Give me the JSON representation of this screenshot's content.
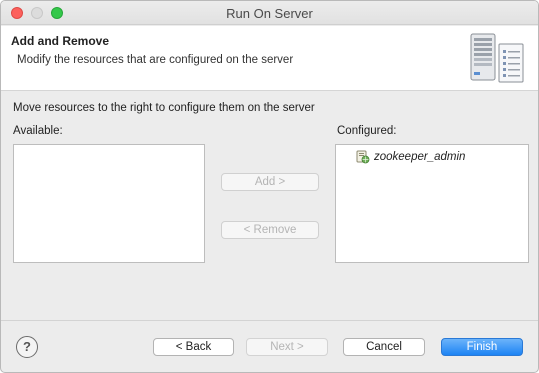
{
  "window": {
    "title": "Run On Server"
  },
  "banner": {
    "title": "Add and Remove",
    "description": "Modify the resources that are configured on the server",
    "icon": "server-wizard-icon"
  },
  "content": {
    "instruction": "Move resources to the right to configure them on the server",
    "available_label": "Available:",
    "configured_label": "Configured:",
    "available_items": [],
    "configured_items": [
      {
        "label": "zookeeper_admin",
        "icon": "web-module-icon"
      }
    ],
    "add_button": "Add >",
    "remove_button": "< Remove"
  },
  "footer": {
    "help_icon": "help-icon",
    "help_glyph": "?",
    "back_button": "< Back",
    "next_button": "Next >",
    "cancel_button": "Cancel",
    "finish_button": "Finish"
  },
  "colors": {
    "accent": "#1d83f4",
    "close": "#fc605c",
    "maximize": "#34c84a"
  }
}
